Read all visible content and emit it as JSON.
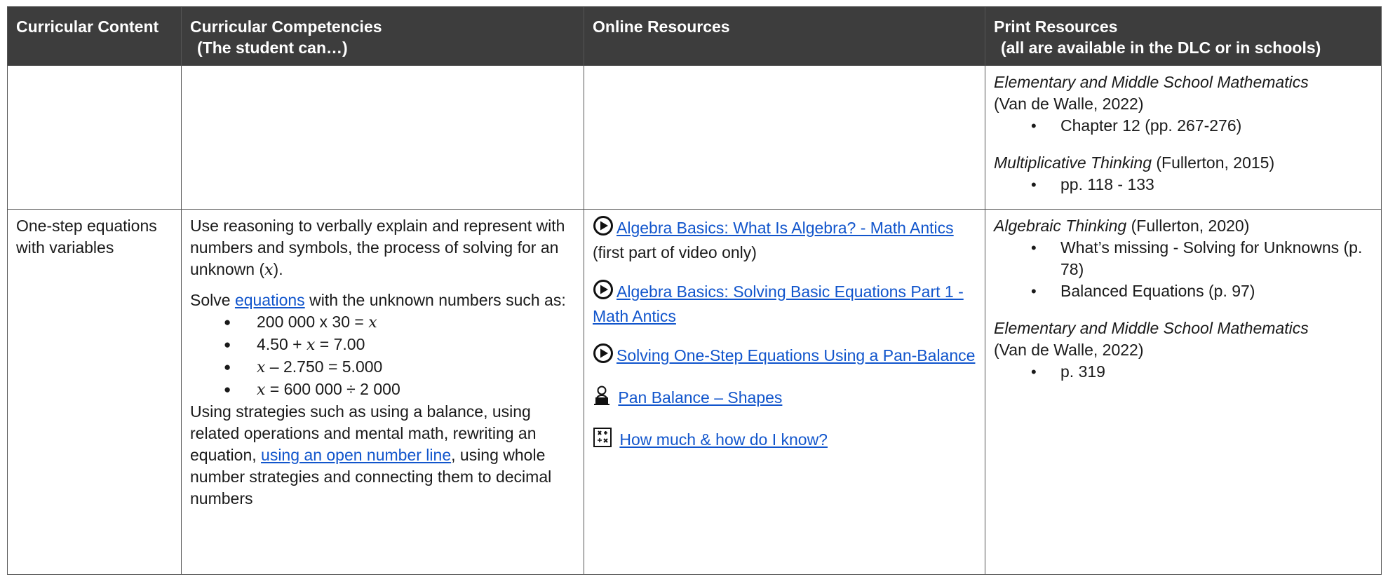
{
  "table": {
    "headers": {
      "content": "Curricular Content",
      "competencies": "Curricular Competencies",
      "competencies_sub": "(The student can…)",
      "online": "Online Resources",
      "print": "Print Resources",
      "print_sub": "(all are available in the DLC or in schools)"
    },
    "row1": {
      "print": {
        "book1_title": "Elementary and Middle School Mathematics",
        "book1_cite": "(Van de Walle, 2022)",
        "book1_items": [
          "Chapter 12 (pp. 267-276)"
        ],
        "book2_title": "Multiplicative Thinking",
        "book2_cite": " (Fullerton, 2015)",
        "book2_items": [
          "pp. 118 - 133"
        ]
      }
    },
    "row2": {
      "content": "One-step equations with variables",
      "competencies": {
        "p1": "Use reasoning to verbally explain and represent with numbers and symbols, the process of solving for an unknown (",
        "p1_var": "x",
        "p1_end": ").",
        "p2_start": "Solve ",
        "p2_link": "equations",
        "p2_end": " with the unknown numbers such as:",
        "eq": [
          {
            "pre": "200 000 x 30 = ",
            "var": "x",
            "post": ""
          },
          {
            "pre": "4.50 + ",
            "var": "x",
            "post": " = 7.00"
          },
          {
            "pre": "",
            "var": "x",
            "post": " – 2.750 = 5.000"
          },
          {
            "pre": "",
            "var": "x",
            "post": " = 600 000 ÷ 2 000"
          }
        ],
        "p3_start": "Using strategies such as using a balance, using related operations and mental math, rewriting an equation, ",
        "p3_link": "using an open number line",
        "p3_end": ", using whole number strategies and connecting them to decimal numbers"
      },
      "online": [
        {
          "icon": "play-icon",
          "label": "Algebra Basics: What Is Algebra? - Math Antics",
          "note": "(first part of video only)"
        },
        {
          "icon": "play-icon",
          "label": "Algebra Basics: Solving Basic Equations Part 1 - Math Antics",
          "note": ""
        },
        {
          "icon": "play-icon",
          "label": "Solving One-Step Equations Using a Pan-Balance",
          "note": ""
        },
        {
          "icon": "student-computer-icon",
          "label": "Pan Balance – Shapes",
          "note": ""
        },
        {
          "icon": "math-operations-icon",
          "label": "How much & how do I know?",
          "note": ""
        }
      ],
      "print": {
        "book1_title": "Algebraic Thinking",
        "book1_cite": " (Fullerton, 2020)",
        "book1_items": [
          "What’s missing - Solving for Unknowns (p. 78)",
          "Balanced Equations (p. 97)"
        ],
        "book2_title": "Elementary and Middle School Mathematics",
        "book2_cite": "(Van de Walle, 2022)",
        "book2_items": [
          "p. 319"
        ]
      }
    }
  },
  "colors": {
    "header_bg": "#3d3d3d",
    "header_text": "#ffffff",
    "link": "#1155cc",
    "border": "#555555"
  }
}
